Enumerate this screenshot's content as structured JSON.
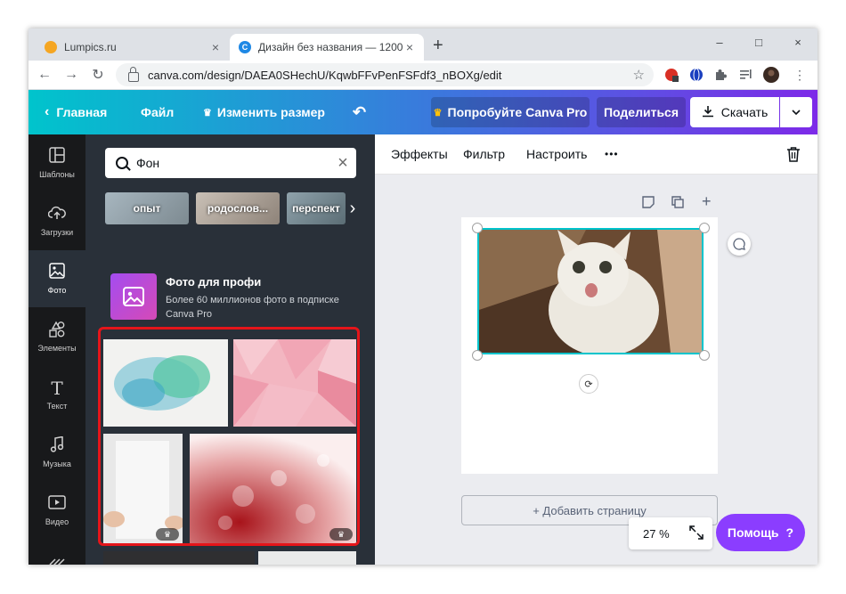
{
  "browser": {
    "tabs": [
      {
        "title": "Lumpics.ru",
        "close": "×"
      },
      {
        "title": "Дизайн без названия — 1200 ×",
        "close": "×"
      }
    ],
    "new_tab": "+",
    "window_controls": [
      "–",
      "□",
      "×"
    ],
    "url": "canva.com/design/DAEA0SHechU/KqwbFFvPenFSFdf3_nBOXg/edit",
    "favicon_letter": "C"
  },
  "header": {
    "home_label": "Главная",
    "file_label": "Файл",
    "resize_label": "Изменить размер",
    "pro_label": "Попробуйте Canva Pro",
    "share_label": "Поделиться",
    "download_label": "Скачать"
  },
  "rail": {
    "items": [
      {
        "label": "Шаблоны",
        "icon": "templates-icon"
      },
      {
        "label": "Загрузки",
        "icon": "upload-icon"
      },
      {
        "label": "Фото",
        "icon": "photo-icon"
      },
      {
        "label": "Элементы",
        "icon": "elements-icon"
      },
      {
        "label": "Текст",
        "icon": "text-icon"
      },
      {
        "label": "Музыка",
        "icon": "music-icon"
      },
      {
        "label": "Видео",
        "icon": "video-icon"
      }
    ],
    "text_glyph": "T"
  },
  "panel": {
    "search_value": "Фон",
    "chips": [
      "опыт",
      "родослов...",
      "перспект"
    ],
    "pro_card": {
      "title": "Фото для профи",
      "description": "Более 60 миллионов фото в подписке Canva Pro"
    }
  },
  "editor": {
    "toolbar": [
      "Эффекты",
      "Фильтр",
      "Настроить",
      "•••"
    ],
    "add_page_label": "+ Добавить страницу",
    "zoom": "27 %",
    "help_label": "Помощь",
    "help_mark": "?"
  },
  "colors": {
    "accent_purple": "#8b3dff",
    "selection_cyan": "#00c4cc",
    "highlight_red": "#e5151a"
  }
}
